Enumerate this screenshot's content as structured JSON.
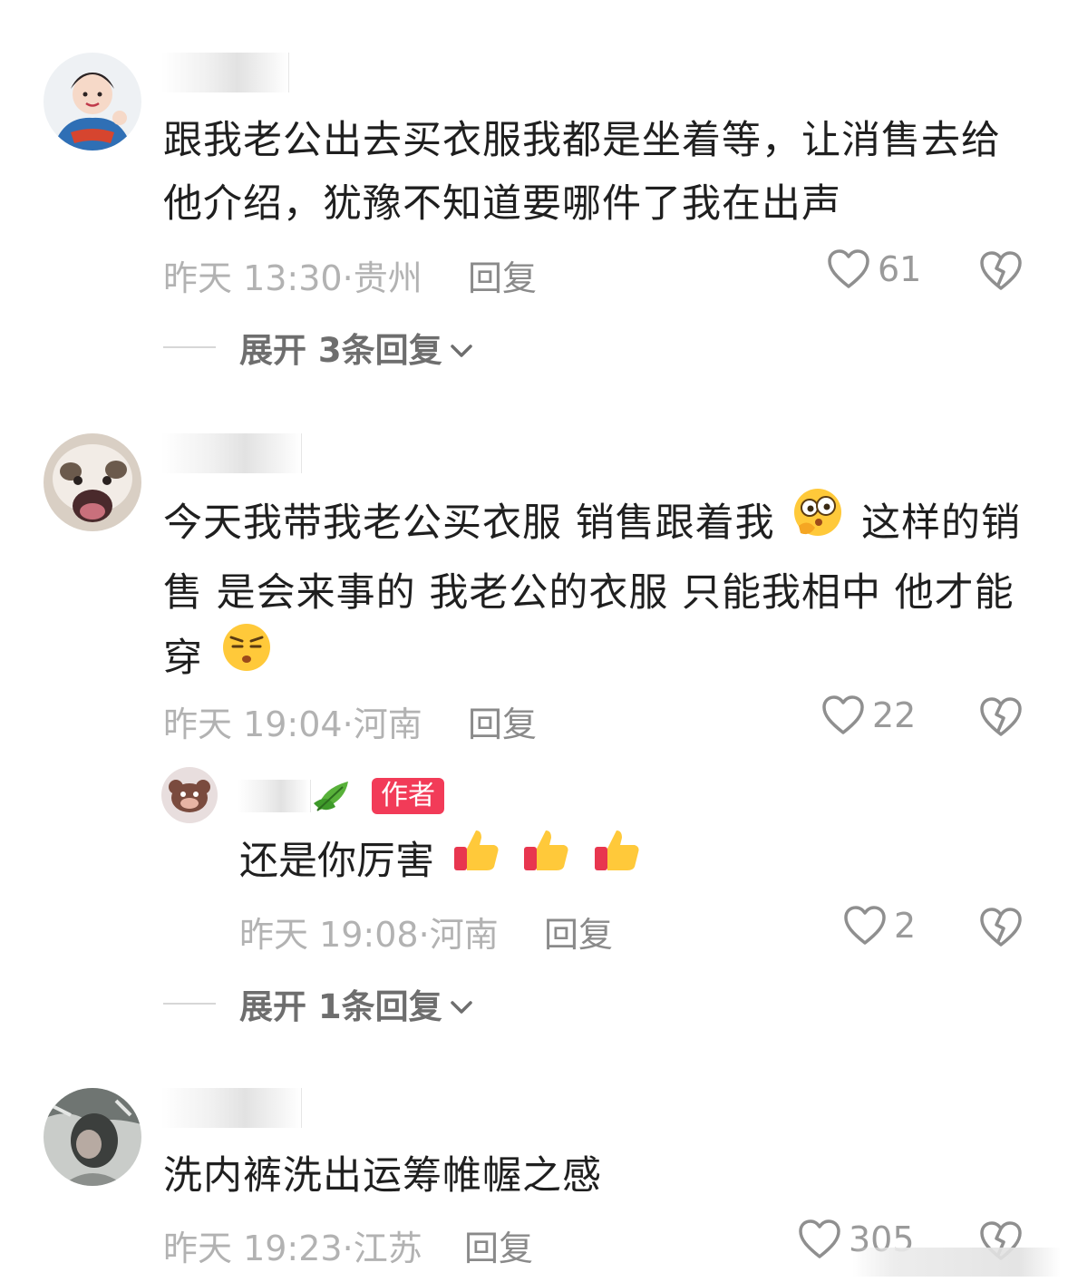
{
  "comments": [
    {
      "text": "跟我老公出去买衣服我都是坐着等，让消售去给他介绍，犹豫不知道要哪件了我在出声",
      "time": "昨天 13:30",
      "location": "贵州",
      "reply_label": "回复",
      "likes": "61",
      "expand_label": "展开 3条回复"
    },
    {
      "text_a": "今天我带我老公买衣服 销售跟着我",
      "text_b": "这样的销售 是会来事的 我老公的衣服 只能我相中 他才能穿",
      "time": "昨天 19:04",
      "location": "河南",
      "reply_label": "回复",
      "likes": "22",
      "author_reply": {
        "badge": "作者",
        "text": "还是你厉害",
        "time": "昨天 19:08",
        "location": "河南",
        "reply_label": "回复",
        "likes": "2"
      },
      "expand_label": "展开 1条回复"
    },
    {
      "text": "洗内裤洗出运筹帷幄之感",
      "time": "昨天 19:23",
      "location": "江苏",
      "reply_label": "回复",
      "likes": "305"
    }
  ],
  "icons": {
    "like": "heart-outline-icon",
    "dislike": "broken-heart-icon",
    "expand": "chevron-down-icon"
  },
  "colors": {
    "badge": "#f23b58",
    "meta": "#b2b2b2",
    "text": "#1f1f1f"
  }
}
